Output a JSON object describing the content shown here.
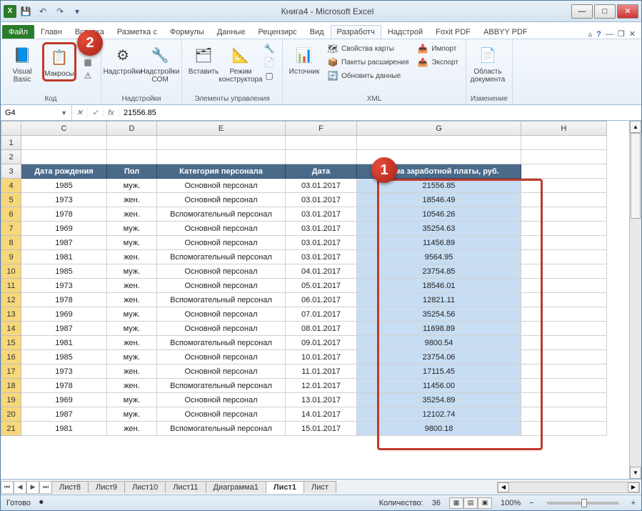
{
  "window": {
    "title": "Книга4 - Microsoft Excel"
  },
  "ribbon": {
    "tabs": [
      "Файл",
      "Главн",
      "Вставка",
      "Разметка с",
      "Формулы",
      "Данные",
      "Рецензирс",
      "Вид",
      "Разработч",
      "Надстрой",
      "Foxit PDF",
      "ABBYY PDF"
    ],
    "active_tab": "Разработч",
    "groups": {
      "code": {
        "label": "Код",
        "visual_basic": "Visual Basic",
        "macros": "Макросы"
      },
      "addins": {
        "label": "Надстройки",
        "addins": "Надстройки",
        "com_addins": "Надстройки COM"
      },
      "controls": {
        "label": "Элементы управления",
        "insert": "Вставить",
        "design_mode": "Режим конструктора"
      },
      "xml": {
        "label": "XML",
        "source": "Источник",
        "map_props": "Свойства карты",
        "exp_packs": "Пакеты расширения",
        "refresh": "Обновить данные",
        "import": "Импорт",
        "export": "Экспорт"
      },
      "modify": {
        "label": "Изменение",
        "doc_panel": "Область документа"
      }
    }
  },
  "name_box": "G4",
  "formula": "21556.85",
  "columns": [
    "C",
    "D",
    "E",
    "F",
    "G",
    "H"
  ],
  "headers": {
    "C": "Дата рождения",
    "D": "Пол",
    "E": "Категория персонала",
    "F": "Дата",
    "G": "Сумма заработной платы, руб."
  },
  "rows": [
    {
      "n": 4,
      "C": "1985",
      "D": "муж.",
      "E": "Основной персонал",
      "F": "03.01.2017",
      "G": "21556.85"
    },
    {
      "n": 5,
      "C": "1973",
      "D": "жен.",
      "E": "Основной персонал",
      "F": "03.01.2017",
      "G": "18546.49"
    },
    {
      "n": 6,
      "C": "1978",
      "D": "жен.",
      "E": "Вспомогательный персонал",
      "F": "03.01.2017",
      "G": "10546.26"
    },
    {
      "n": 7,
      "C": "1969",
      "D": "муж.",
      "E": "Основной персонал",
      "F": "03.01.2017",
      "G": "35254.63"
    },
    {
      "n": 8,
      "C": "1987",
      "D": "муж.",
      "E": "Основной персонал",
      "F": "03.01.2017",
      "G": "11456.89"
    },
    {
      "n": 9,
      "C": "1981",
      "D": "жен.",
      "E": "Вспомогательный персонал",
      "F": "03.01.2017",
      "G": "9564.95"
    },
    {
      "n": 10,
      "C": "1985",
      "D": "муж.",
      "E": "Основной персонал",
      "F": "04.01.2017",
      "G": "23754.85"
    },
    {
      "n": 11,
      "C": "1973",
      "D": "жен.",
      "E": "Основной персонал",
      "F": "05.01.2017",
      "G": "18546.01"
    },
    {
      "n": 12,
      "C": "1978",
      "D": "жен.",
      "E": "Вспомогательный персонал",
      "F": "06.01.2017",
      "G": "12821.11"
    },
    {
      "n": 13,
      "C": "1969",
      "D": "муж.",
      "E": "Основной персонал",
      "F": "07.01.2017",
      "G": "35254.56"
    },
    {
      "n": 14,
      "C": "1987",
      "D": "муж.",
      "E": "Основной персонал",
      "F": "08.01.2017",
      "G": "11698.89"
    },
    {
      "n": 15,
      "C": "1981",
      "D": "жен.",
      "E": "Вспомогательный персонал",
      "F": "09.01.2017",
      "G": "9800.54"
    },
    {
      "n": 16,
      "C": "1985",
      "D": "муж.",
      "E": "Основной персонал",
      "F": "10.01.2017",
      "G": "23754.06"
    },
    {
      "n": 17,
      "C": "1973",
      "D": "жен.",
      "E": "Основной персонал",
      "F": "11.01.2017",
      "G": "17115.45"
    },
    {
      "n": 18,
      "C": "1978",
      "D": "жен.",
      "E": "Вспомогательный персонал",
      "F": "12.01.2017",
      "G": "11456.00"
    },
    {
      "n": 19,
      "C": "1969",
      "D": "муж.",
      "E": "Основной персонал",
      "F": "13.01.2017",
      "G": "35254.89"
    },
    {
      "n": 20,
      "C": "1987",
      "D": "муж.",
      "E": "Основной персонал",
      "F": "14.01.2017",
      "G": "12102.74"
    },
    {
      "n": 21,
      "C": "1981",
      "D": "жен.",
      "E": "Вспомогательный персонал",
      "F": "15.01.2017",
      "G": "9800.18"
    }
  ],
  "sheets": [
    "Лист8",
    "Лист9",
    "Лист10",
    "Лист11",
    "Диаграмма1",
    "Лист1",
    "Лист"
  ],
  "active_sheet": "Лист1",
  "status": {
    "ready": "Готово",
    "count_label": "Количество:",
    "count_value": "36",
    "zoom": "100%"
  },
  "badges": {
    "one": "1",
    "two": "2"
  }
}
